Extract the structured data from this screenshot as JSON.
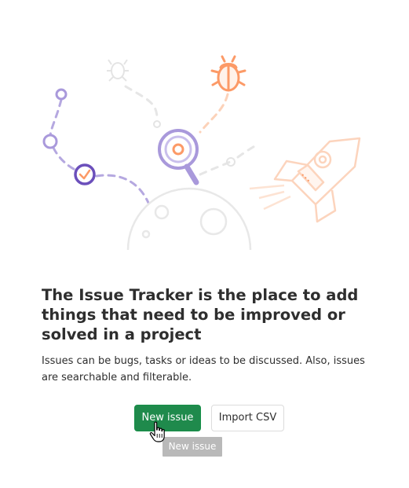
{
  "empty_state": {
    "title": "The Issue Tracker is the place to add things that need to be improved or solved in a project",
    "description": "Issues can be bugs, tasks or ideas to be discussed. Also, issues are searchable and filterable."
  },
  "actions": {
    "new_issue_label": "New issue",
    "import_csv_label": "Import CSV"
  },
  "tooltip": {
    "text": "New issue"
  },
  "colors": {
    "primary_button": "#1f8a4c",
    "illustration_purple": "#6b4fbb",
    "illustration_orange": "#fc9a67"
  },
  "icons": [
    "bug-icon",
    "magnifier-icon",
    "checkmark-icon",
    "rocket-icon",
    "planet-icon",
    "pointer-hand-icon"
  ]
}
